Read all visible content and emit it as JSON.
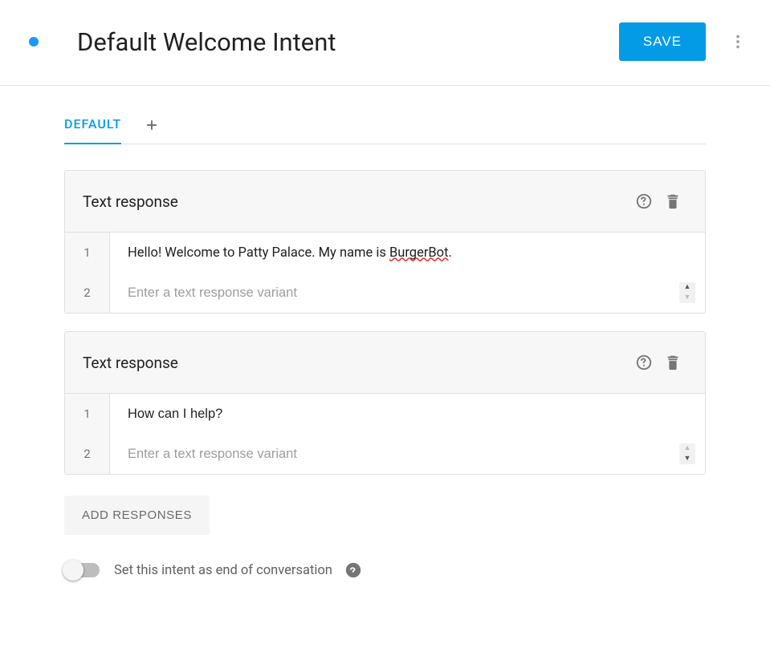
{
  "header": {
    "title": "Default Welcome Intent",
    "save_label": "SAVE"
  },
  "tabs": {
    "default_label": "DEFAULT"
  },
  "responses": [
    {
      "title": "Text response",
      "rows": [
        {
          "num": "1",
          "value_plain": "Hello! Welcome to Patty Palace. My name is ",
          "value_marked": "BurgerBot",
          "value_tail": "."
        },
        {
          "num": "2",
          "placeholder": "Enter a text response variant",
          "stepper_up_dim": false,
          "stepper_down_dim": true
        }
      ]
    },
    {
      "title": "Text response",
      "rows": [
        {
          "num": "1",
          "value": "How can I help?"
        },
        {
          "num": "2",
          "placeholder": "Enter a text response variant",
          "stepper_up_dim": true,
          "stepper_down_dim": false
        }
      ]
    }
  ],
  "add_responses_label": "ADD RESPONSES",
  "end_of_conversation": {
    "label": "Set this intent as end of conversation",
    "enabled": false
  }
}
